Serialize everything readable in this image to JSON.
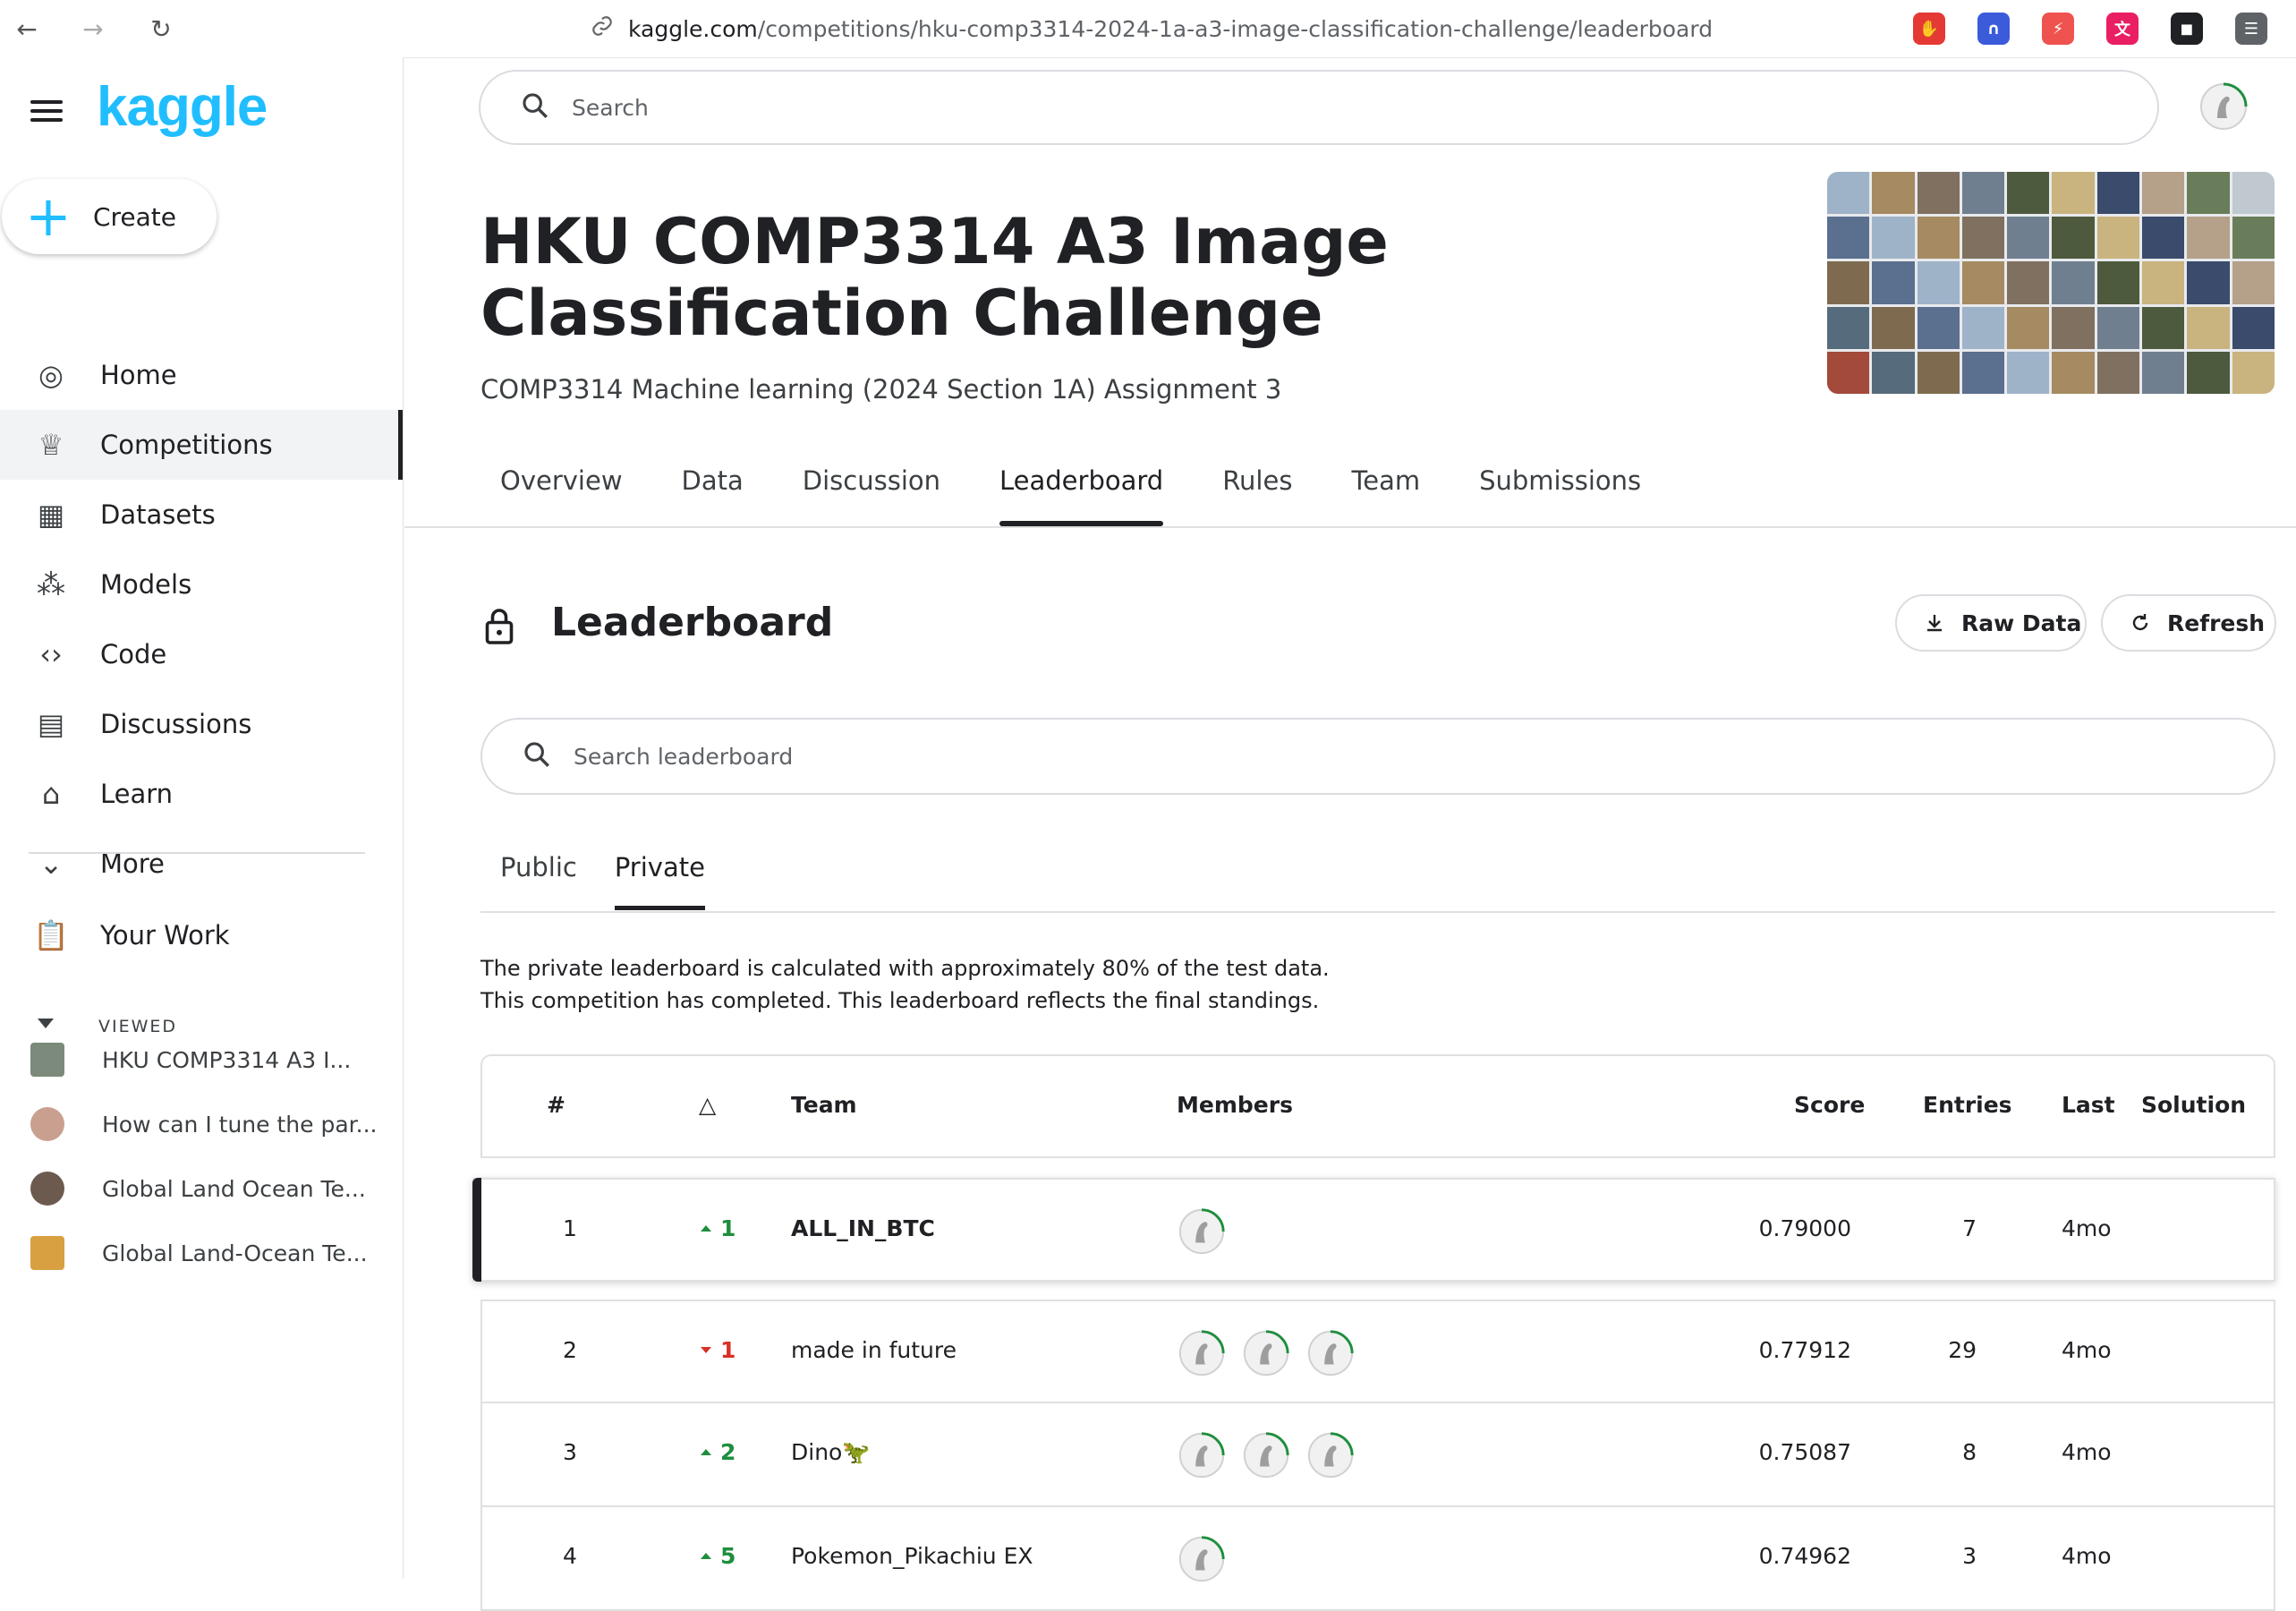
{
  "browser": {
    "url_host": "kaggle.com",
    "url_path": "/competitions/hku-comp3314-2024-1a-a3-image-classification-challenge/leaderboard",
    "extensions": [
      {
        "name": "ublock-icon",
        "color": "#e53935",
        "glyph": "✋"
      },
      {
        "name": "arc-icon",
        "color": "#3b5bdb",
        "glyph": "∩"
      },
      {
        "name": "bolt-icon",
        "color": "#ef5350",
        "glyph": "⚡"
      },
      {
        "name": "translate-icon",
        "color": "#e91e63",
        "glyph": "文"
      },
      {
        "name": "incognito-icon",
        "color": "#202124",
        "glyph": "◼"
      },
      {
        "name": "settings-extension-icon",
        "color": "#5f6368",
        "glyph": "☰"
      }
    ]
  },
  "sidebar": {
    "logo": "kaggle",
    "create_label": "Create",
    "items": [
      {
        "label": "Home",
        "icon": "compass-icon",
        "glyph": "◎"
      },
      {
        "label": "Competitions",
        "icon": "trophy-icon",
        "glyph": "♕"
      },
      {
        "label": "Datasets",
        "icon": "table-icon",
        "glyph": "▦"
      },
      {
        "label": "Models",
        "icon": "models-icon",
        "glyph": "⁂"
      },
      {
        "label": "Code",
        "icon": "code-icon",
        "glyph": "‹›"
      },
      {
        "label": "Discussions",
        "icon": "discussion-icon",
        "glyph": "▤"
      },
      {
        "label": "Learn",
        "icon": "graduation-cap-icon",
        "glyph": "⌂"
      },
      {
        "label": "More",
        "icon": "chevron-down-icon",
        "glyph": "⌄"
      }
    ],
    "your_work": "Your Work",
    "viewed_label": "VIEWED",
    "recent": [
      {
        "label": "HKU COMP3314 A3 I...",
        "thumb_color": "#7b8a7a"
      },
      {
        "label": "How can I tune the par...",
        "thumb_color": "#c9a090"
      },
      {
        "label": "Global Land Ocean Te...",
        "thumb_color": "#6d5a4e"
      },
      {
        "label": "Global Land-Ocean Te...",
        "thumb_color": "#d8a040"
      }
    ]
  },
  "header": {
    "search_placeholder": "Search",
    "title": "HKU COMP3314 A3 Image Classification Challenge",
    "subtitle": "COMP3314 Machine learning (2024 Section 1A) Assignment 3",
    "tabs": [
      "Overview",
      "Data",
      "Discussion",
      "Leaderboard",
      "Rules",
      "Team",
      "Submissions"
    ],
    "active_tab": "Leaderboard"
  },
  "leaderboard": {
    "title": "Leaderboard",
    "raw_data_label": "Raw Data",
    "refresh_label": "Refresh",
    "search_placeholder": "Search leaderboard",
    "subtabs": [
      "Public",
      "Private"
    ],
    "active_subtab": "Private",
    "note_line1": "The private leaderboard is calculated with approximately 80% of the test data.",
    "note_line2": "This competition has completed. This leaderboard reflects the final standings.",
    "columns": {
      "rank": "#",
      "delta": "△",
      "team": "Team",
      "members": "Members",
      "score": "Score",
      "entries": "Entries",
      "last": "Last",
      "solution": "Solution"
    },
    "rows": [
      {
        "rank": "1",
        "dir": "up",
        "delta": "1",
        "team": "ALL_IN_BTC",
        "members": 1,
        "score": "0.79000",
        "entries": "7",
        "last": "4mo"
      },
      {
        "rank": "2",
        "dir": "down",
        "delta": "1",
        "team": "made in future",
        "members": 3,
        "score": "0.77912",
        "entries": "29",
        "last": "4mo"
      },
      {
        "rank": "3",
        "dir": "up",
        "delta": "2",
        "team": "Dino🦖",
        "members": 3,
        "score": "0.75087",
        "entries": "8",
        "last": "4mo"
      },
      {
        "rank": "4",
        "dir": "up",
        "delta": "5",
        "team": "Pokemon_Pikachiu EX",
        "members": 1,
        "score": "0.74962",
        "entries": "3",
        "last": "4mo"
      }
    ]
  },
  "colors": {
    "accent": "#20beff",
    "up": "#1e8e3e",
    "down": "#d93025",
    "thumb_palette": [
      "#9fb3c8",
      "#6f7f8f",
      "#3a4b6b",
      "#c0c8d0",
      "#8a9aa6",
      "#5d6d4f",
      "#7e6b4f",
      "#a58a62",
      "#4d5a3d",
      "#b5a089",
      "#2f3a4a",
      "#d7dde3",
      "#a34a3a",
      "#5b6f8f",
      "#807060",
      "#c9b37e",
      "#6a7d5a",
      "#3d4f5f",
      "#9c8c7c",
      "#566b7b"
    ]
  }
}
